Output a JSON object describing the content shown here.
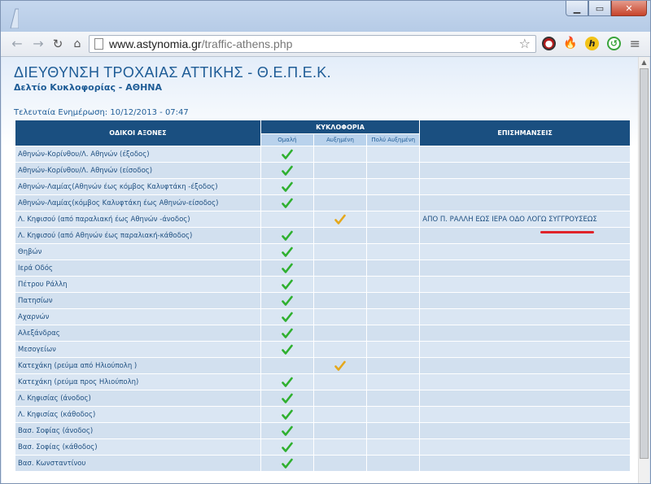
{
  "browser": {
    "url_domain": "www.astynomia.gr",
    "url_path": "/traffic-athens.php"
  },
  "page": {
    "title": "ΔΙΕΥΘΥΝΣΗ ΤΡΟΧΑΙΑΣ ΑΤΤΙΚΗΣ - Θ.Ε.Π.Ε.Κ.",
    "subtitle": "Δελτίο Κυκλοφορίας - ΑΘΗΝΑ",
    "last_update": "Τελευταία Ενημέρωση: 10/12/2013 - 07:47"
  },
  "table": {
    "headers": {
      "roads": "ΟΔΙΚΟΙ ΑΞΟΝΕΣ",
      "traffic": "ΚΥΚΛΟΦΟΡΙΑ",
      "notes": "ΕΠΙΣΗΜΑΝΣΕΙΣ"
    },
    "subheaders": [
      "Ομαλή",
      "Αυξημένη",
      "Πολύ Αυξημένη"
    ],
    "rows": [
      {
        "road": "Αθηνών-Κορίνθου/Λ. Αθηνών (έξοδος)",
        "status": "normal",
        "note": ""
      },
      {
        "road": "Αθηνών-Κορίνθου/Λ. Αθηνών (είσοδος)",
        "status": "normal",
        "note": ""
      },
      {
        "road": "Αθηνών-Λαμίας(Αθηνών έως κόμβος Καλυφτάκη -έξοδος)",
        "status": "normal",
        "note": ""
      },
      {
        "road": "Αθηνών-Λαμίας(κόμβος Καλυφτάκη έως Αθηνών-είσοδος)",
        "status": "normal",
        "note": ""
      },
      {
        "road": "Λ. Κηφισού (από παραλιακή έως Αθηνών -άνοδος)",
        "status": "increased",
        "note": "ΑΠΟ Π. ΡΑΛΛΗ ΕΩΣ ΙΕΡΑ ΟΔΟ ΛΟΓΩ ΣΥΓΓΡΟΥΣΕΩΣ"
      },
      {
        "road": "Λ. Κηφισού (από Αθηνών έως παραλιακή-κάθοδος)",
        "status": "normal",
        "note": ""
      },
      {
        "road": "Θηβών",
        "status": "normal",
        "note": ""
      },
      {
        "road": "Ιερά Οδός",
        "status": "normal",
        "note": ""
      },
      {
        "road": "Πέτρου Ράλλη",
        "status": "normal",
        "note": ""
      },
      {
        "road": "Πατησίων",
        "status": "normal",
        "note": ""
      },
      {
        "road": "Αχαρνών",
        "status": "normal",
        "note": ""
      },
      {
        "road": "Αλεξάνδρας",
        "status": "normal",
        "note": ""
      },
      {
        "road": "Μεσογείων",
        "status": "normal",
        "note": ""
      },
      {
        "road": "Κατεχάκη (ρεύμα από Ηλιούπολη )",
        "status": "increased",
        "note": ""
      },
      {
        "road": "Κατεχάκη (ρεύμα προς Ηλιούπολη)",
        "status": "normal",
        "note": ""
      },
      {
        "road": "Λ. Κηφισίας (άνοδος)",
        "status": "normal",
        "note": ""
      },
      {
        "road": "Λ. Κηφισίας (κάθοδος)",
        "status": "normal",
        "note": ""
      },
      {
        "road": "Βασ. Σοφίας (άνοδος)",
        "status": "normal",
        "note": ""
      },
      {
        "road": "Βασ. Σοφίας (κάθοδος)",
        "status": "normal",
        "note": ""
      },
      {
        "road": "Βασ. Κωνσταντίνου",
        "status": "normal",
        "note": ""
      }
    ]
  },
  "colors": {
    "check_normal": "#2fb02f",
    "check_increased": "#e5a81c",
    "highlight": "#e0232a"
  }
}
